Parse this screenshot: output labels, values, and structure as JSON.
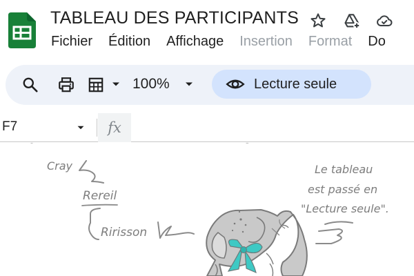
{
  "window": {
    "title": "TABLEAU DES PARTICIPANTS",
    "title_icons": [
      "star-icon",
      "drive-add-icon",
      "cloud-icon"
    ]
  },
  "menu": {
    "items": [
      {
        "label": "Fichier",
        "enabled": true
      },
      {
        "label": "Édition",
        "enabled": true
      },
      {
        "label": "Affichage",
        "enabled": true
      },
      {
        "label": "Insertion",
        "enabled": false
      },
      {
        "label": "Format",
        "enabled": false
      },
      {
        "label": "Do",
        "enabled": true
      }
    ]
  },
  "toolbar": {
    "icons": [
      "search-icon",
      "print-icon",
      "table-icon",
      "chevron-down-icon"
    ],
    "zoom": "100%",
    "mode_label": "Lecture seule",
    "mode_icon": "eye-icon"
  },
  "formula_bar": {
    "cell_ref": "F7",
    "fx_symbol": "fx",
    "content": ""
  },
  "sketch": {
    "labels": {
      "cray": "Cray",
      "rereil": "Rereil",
      "ririsson": "Ririsson",
      "note_line1": "Le tableau",
      "note_line2": "est passé en",
      "note_line3": "\"Lecture seule\"."
    },
    "colors": {
      "pencil": "#7d7d7d",
      "elephant": "#c9c9c9",
      "bow": "#3ec9c4"
    }
  },
  "colors": {
    "sheets_green": "#188038",
    "chip_blue": "#d3e3fd",
    "toolbar_bg": "#eef2f9",
    "disabled_text": "#9aa0a6"
  }
}
